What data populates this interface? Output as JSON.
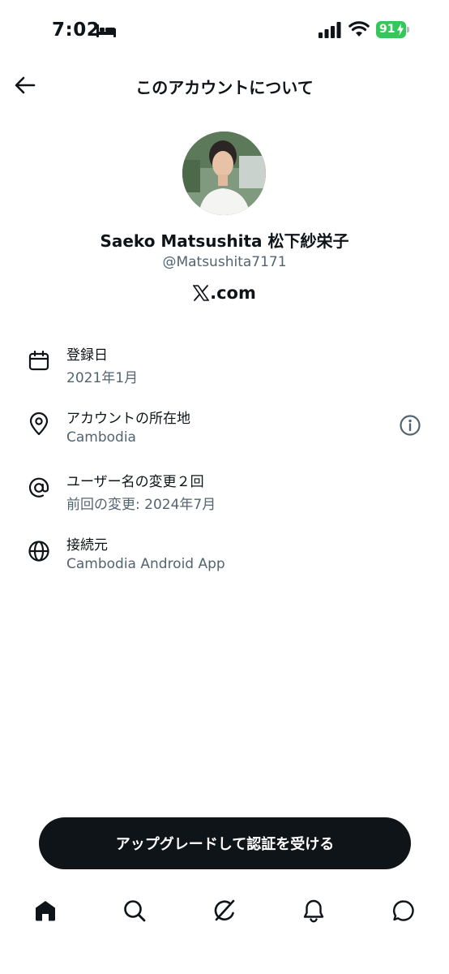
{
  "status_bar": {
    "time": "7:02",
    "battery": "91",
    "icons": [
      "bed-icon",
      "signal-icon",
      "wifi-icon",
      "battery-icon"
    ]
  },
  "header": {
    "back_icon": "arrow-left-icon",
    "title": "このアカウントについて"
  },
  "profile": {
    "display_name": "Saeko Matsushita 松下紗栄子",
    "handle": "@Matsushita7171",
    "affiliation": ".com",
    "affiliation_logo": "X"
  },
  "info": [
    {
      "icon": "calendar-icon",
      "label": "登録日",
      "value": "2021年1月"
    },
    {
      "icon": "location-pin-icon",
      "label": "アカウントの所在地",
      "value": "Cambodia",
      "action_icon": "info-icon"
    },
    {
      "icon": "at-sign-icon",
      "label": "ユーザー名の変更２回",
      "value": "前回の変更: 2024年7月"
    },
    {
      "icon": "globe-icon",
      "label": "接続元",
      "value": "Cambodia Android App"
    }
  ],
  "upgrade_button": {
    "label": "アップグレードして認証を受ける"
  },
  "bottom_nav": {
    "items": [
      "home-icon",
      "search-icon",
      "grok-icon",
      "bell-icon",
      "messages-icon"
    ]
  },
  "colors": {
    "text": "#0f1419",
    "secondary": "#536471",
    "battery": "#34c759",
    "button": "#0f1419"
  }
}
